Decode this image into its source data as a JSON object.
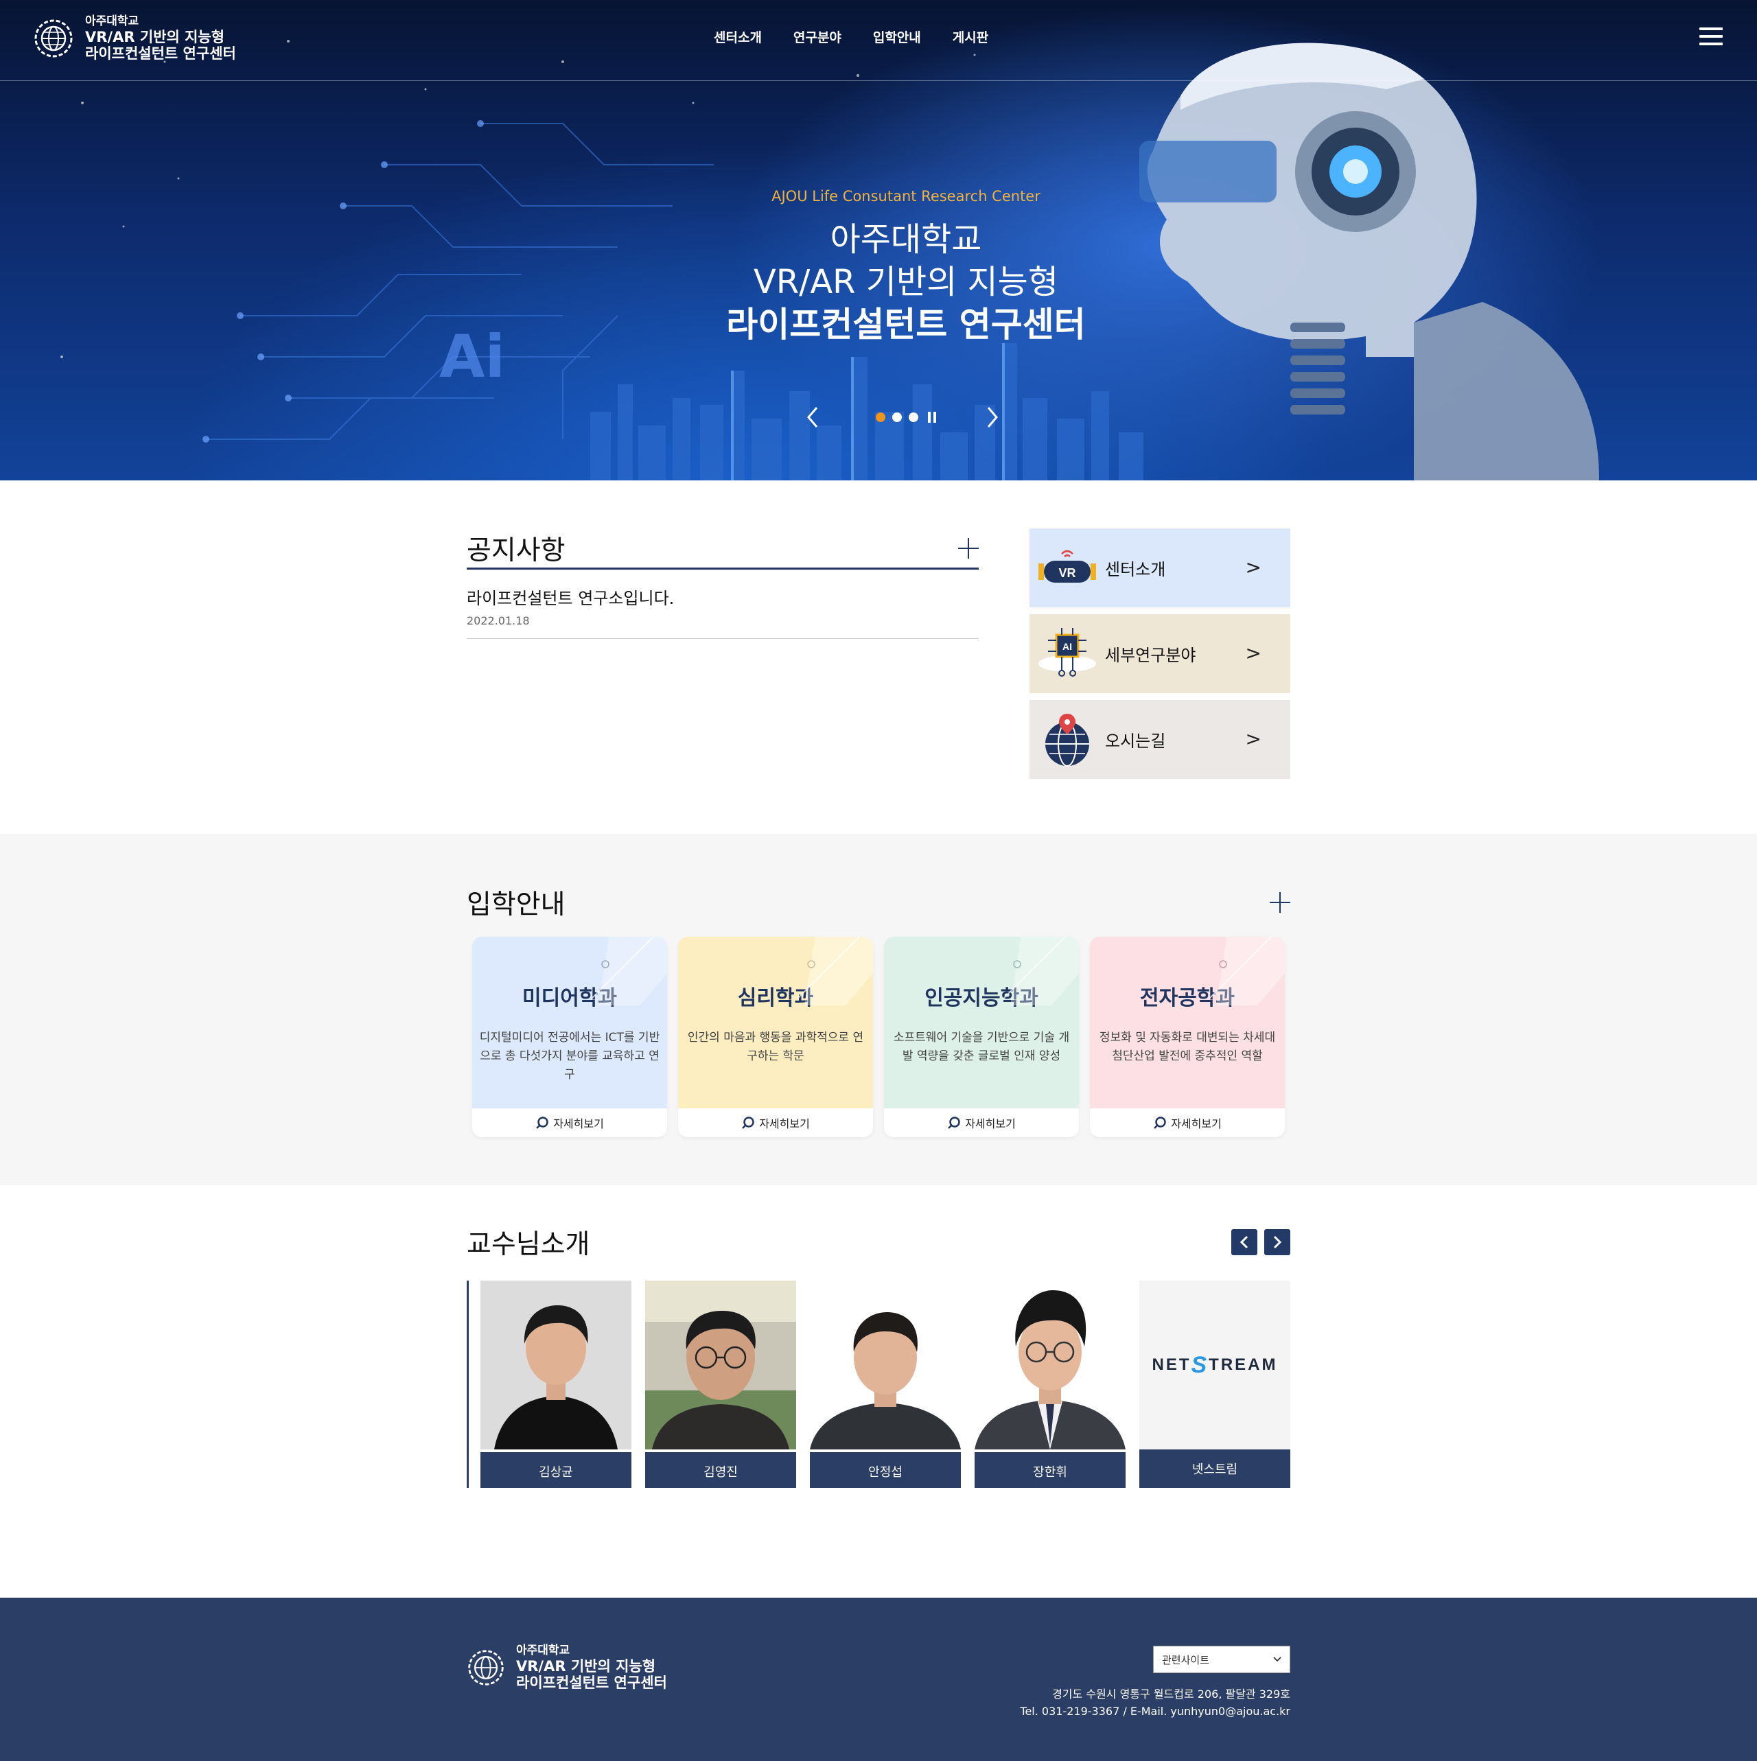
{
  "header": {
    "logo": {
      "line1": "아주대학교",
      "line2": "VR/AR 기반의 지능형",
      "line3": "라이프컨설턴트 연구센터"
    },
    "nav": [
      "센터소개",
      "연구분야",
      "입학안내",
      "게시판"
    ]
  },
  "hero": {
    "eyebrow": "AJOU Life Consutant Research Center",
    "title_line1": "아주대학교",
    "title_line2": "VR/AR 기반의 지능형",
    "title_line3": "라이프컨설턴트 연구센터",
    "ai_text": "Ai",
    "slides_total": 3,
    "slide_active": 1
  },
  "notice": {
    "title": "공지사항",
    "items": [
      {
        "title": "라이프컨설턴트 연구소입니다.",
        "date": "2022.01.18"
      }
    ]
  },
  "quick": [
    {
      "label": "센터소개",
      "icon": "vr-headset-icon",
      "bg": "#dbe8fb"
    },
    {
      "label": "세부연구분야",
      "icon": "ai-chip-icon",
      "bg": "#efe7d6"
    },
    {
      "label": "오시는길",
      "icon": "globe-pin-icon",
      "bg": "#ebe8e6"
    }
  ],
  "admission": {
    "title": "입학안내",
    "depts": [
      {
        "name": "미디어학과",
        "desc": "디지털미디어 전공에서는 ICT를 기반으로 총 다섯가지 분야를 교육하고 연구",
        "more": "자세히보기",
        "bg": "#dde9fc"
      },
      {
        "name": "심리학과",
        "desc": "인간의 마음과 행동을 과학적으로 연구하는 학문",
        "more": "자세히보기",
        "bg": "#fdeec1"
      },
      {
        "name": "인공지능학과",
        "desc": "소프트웨어 기술을 기반으로 기술 개발 역량을 갖춘 글로벌 인재 양성",
        "more": "자세히보기",
        "bg": "#ddf1e9"
      },
      {
        "name": "전자공학과",
        "desc": "정보화 및 자동화로 대변되는 차세대 첨단산업 발전에 중추적인 역할",
        "more": "자세히보기",
        "bg": "#fde0e3"
      }
    ]
  },
  "professors": {
    "title": "교수님소개",
    "list": [
      "김상균",
      "김영진",
      "안정섭",
      "장한휘",
      "넷스트림"
    ],
    "netstream_logo": {
      "part1": "NET",
      "part2": "S",
      "part3": "TREAM"
    }
  },
  "footer": {
    "logo": {
      "line1": "아주대학교",
      "line2": "VR/AR 기반의 지능형",
      "line3": "라이프컨설턴트 연구센터"
    },
    "select_label": "관련사이트",
    "address": "경기도 수원시 영통구 월드컵로 206, 팔달관 329호",
    "contact": "Tel. 031-219-3367 / E-Mail. yunhyun0@ajou.ac.kr"
  }
}
